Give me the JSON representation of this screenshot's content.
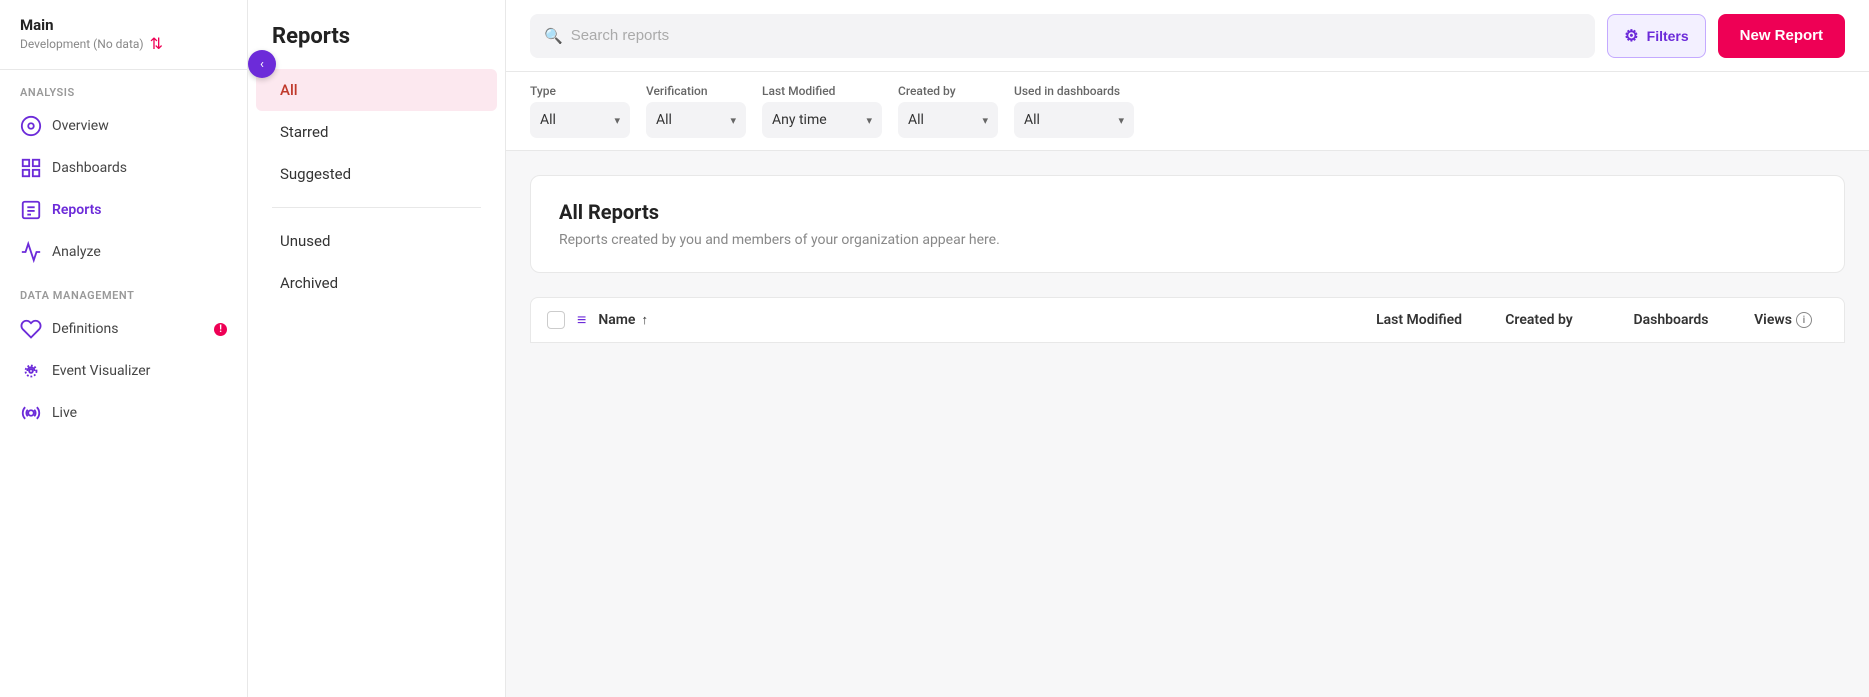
{
  "sidebar": {
    "app_name": "Main",
    "app_sub": "Development (No data)",
    "sections": [
      {
        "label": "Analysis",
        "items": [
          {
            "id": "overview",
            "label": "Overview",
            "icon": "overview-icon",
            "active": false
          },
          {
            "id": "dashboards",
            "label": "Dashboards",
            "icon": "dashboards-icon",
            "active": false
          },
          {
            "id": "reports",
            "label": "Reports",
            "icon": "reports-icon",
            "active": true
          },
          {
            "id": "analyze",
            "label": "Analyze",
            "icon": "analyze-icon",
            "active": false
          }
        ]
      },
      {
        "label": "Data Management",
        "items": [
          {
            "id": "definitions",
            "label": "Definitions",
            "icon": "definitions-icon",
            "active": false,
            "badge": "!"
          },
          {
            "id": "event-visualizer",
            "label": "Event Visualizer",
            "icon": "event-visualizer-icon",
            "active": false
          },
          {
            "id": "live",
            "label": "Live",
            "icon": "live-icon",
            "active": false
          }
        ]
      }
    ]
  },
  "reports_panel": {
    "title": "Reports",
    "filters": [
      {
        "id": "all",
        "label": "All",
        "active": true
      },
      {
        "id": "starred",
        "label": "Starred",
        "active": false
      },
      {
        "id": "suggested",
        "label": "Suggested",
        "active": false
      },
      {
        "id": "unused",
        "label": "Unused",
        "active": false
      },
      {
        "id": "archived",
        "label": "Archived",
        "active": false
      }
    ]
  },
  "topbar": {
    "search_placeholder": "Search reports",
    "filters_label": "Filters",
    "new_report_label": "New Report"
  },
  "filter_bar": {
    "filters": [
      {
        "id": "type",
        "label": "Type",
        "value": "All"
      },
      {
        "id": "verification",
        "label": "Verification",
        "value": "All"
      },
      {
        "id": "last_modified",
        "label": "Last Modified",
        "value": "Any time"
      },
      {
        "id": "created_by",
        "label": "Created by",
        "value": "All"
      },
      {
        "id": "used_in_dashboards",
        "label": "Used in dashboards",
        "value": "All"
      }
    ]
  },
  "all_reports": {
    "title": "All Reports",
    "description": "Reports created by you and members of your organization appear here."
  },
  "table": {
    "columns": [
      {
        "id": "name",
        "label": "Name",
        "sort": "↑"
      },
      {
        "id": "last_modified",
        "label": "Last Modified"
      },
      {
        "id": "created_by",
        "label": "Created by"
      },
      {
        "id": "dashboards",
        "label": "Dashboards"
      },
      {
        "id": "views",
        "label": "Views"
      }
    ]
  },
  "colors": {
    "accent": "#6c2bd9",
    "active_filter_bg": "#fce8ef",
    "active_filter_text": "#c0392b",
    "new_report_bg": "#e05252",
    "badge_bg": "#dd2244"
  }
}
